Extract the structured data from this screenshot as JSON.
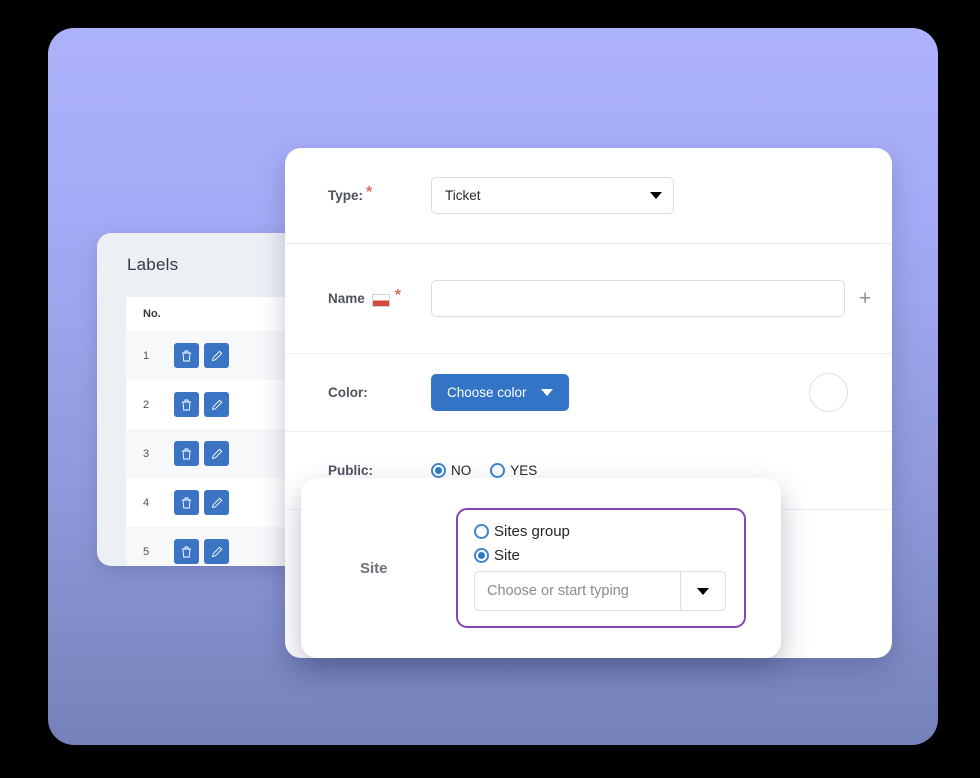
{
  "labels_panel": {
    "title": "Labels",
    "column_header": "No.",
    "rows": [
      {
        "no": "1",
        "delete_icon": "trash-icon",
        "edit_icon": "pencil-icon"
      },
      {
        "no": "2",
        "delete_icon": "trash-icon",
        "edit_icon": "pencil-icon"
      },
      {
        "no": "3",
        "delete_icon": "trash-icon",
        "edit_icon": "pencil-icon"
      },
      {
        "no": "4",
        "delete_icon": "trash-icon",
        "edit_icon": "pencil-icon"
      },
      {
        "no": "5",
        "delete_icon": "trash-icon",
        "edit_icon": "pencil-icon"
      }
    ]
  },
  "form": {
    "type": {
      "label": "Type:",
      "required_marker": "*",
      "value": "Ticket",
      "caret_icon": "chevron-down-icon"
    },
    "name": {
      "label": "Name",
      "flag_icon": "poland-flag-icon",
      "required_marker": "*",
      "value": "",
      "placeholder": "",
      "add_icon": "plus-icon"
    },
    "color": {
      "label": "Color:",
      "button_label": "Choose color",
      "caret_icon": "chevron-down-icon",
      "swatch_value": ""
    },
    "public": {
      "label": "Public:",
      "options": [
        {
          "label": "NO",
          "selected": true
        },
        {
          "label": "YES",
          "selected": false
        }
      ]
    }
  },
  "site_panel": {
    "label": "Site",
    "options": [
      {
        "label": "Sites group",
        "selected": false
      },
      {
        "label": "Site",
        "selected": true
      }
    ],
    "combo": {
      "value": "",
      "placeholder": "Choose or start typing",
      "caret_icon": "chevron-down-icon"
    }
  },
  "colors": {
    "primary_blue": "#3374c6",
    "radio_blue": "#2e7cc8",
    "accent_purple": "#8146b8",
    "required_red": "#e06a60",
    "flag_red": "#d4483f",
    "background_top": "#adb2fa",
    "background_bottom": "#7581b9",
    "labels_card_bg": "#eceff4",
    "row_alt_bg": "#f7f8fa"
  }
}
